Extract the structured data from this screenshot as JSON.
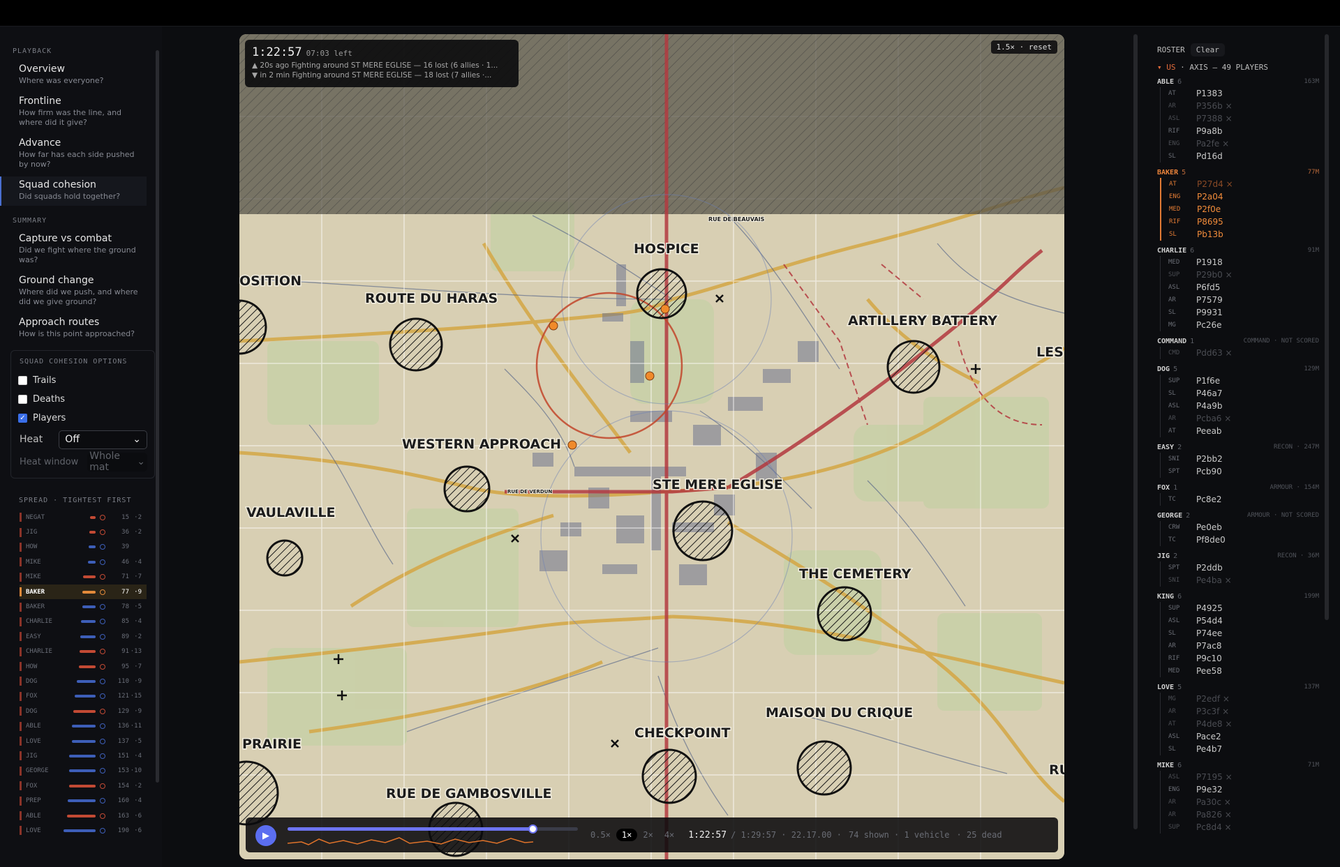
{
  "left": {
    "playback_header": "PLAYBACK",
    "playback": [
      {
        "t": "Overview",
        "d": "Where was everyone?"
      },
      {
        "t": "Frontline",
        "d": "How firm was the line, and where did it give?"
      },
      {
        "t": "Advance",
        "d": "How far has each side pushed by now?"
      },
      {
        "t": "Squad cohesion",
        "d": "Did squads hold together?"
      }
    ],
    "summary_header": "SUMMARY",
    "summary": [
      {
        "t": "Capture vs combat",
        "d": "Did we fight where the ground was?"
      },
      {
        "t": "Ground change",
        "d": "Where did we push, and where did we give ground?"
      },
      {
        "t": "Approach routes",
        "d": "How is this point approached?"
      }
    ],
    "options_header": "SQUAD COHESION OPTIONS",
    "options": {
      "trails": "Trails",
      "deaths": "Deaths",
      "players": "Players",
      "heat_label": "Heat",
      "heat_value": "Off",
      "heatwin_label": "Heat window",
      "heatwin_value": "Whole mat"
    },
    "spread_header": "SPREAD · TIGHTEST FIRST",
    "spread": [
      {
        "n": "NEGAT",
        "v": "15",
        "d": "2",
        "c": "#c24a34"
      },
      {
        "n": "JIG",
        "v": "36",
        "d": "2",
        "c": "#c24a34"
      },
      {
        "n": "HOW",
        "v": "39",
        "d": "",
        "c": "#3d5eb8"
      },
      {
        "n": "MIKE",
        "v": "46",
        "d": "4",
        "c": "#3d5eb8"
      },
      {
        "n": "MIKE",
        "v": "71",
        "d": "7",
        "c": "#c24a34"
      },
      {
        "n": "BAKER",
        "v": "77",
        "d": "9",
        "c": "#e38a3a"
      },
      {
        "n": "BAKER",
        "v": "78",
        "d": "5",
        "c": "#3d5eb8"
      },
      {
        "n": "CHARLIE",
        "v": "85",
        "d": "4",
        "c": "#3d5eb8"
      },
      {
        "n": "EASY",
        "v": "89",
        "d": "2",
        "c": "#3d5eb8"
      },
      {
        "n": "CHARLIE",
        "v": "91",
        "d": "13",
        "c": "#c24a34"
      },
      {
        "n": "HOW",
        "v": "95",
        "d": "7",
        "c": "#c24a34"
      },
      {
        "n": "DOG",
        "v": "110",
        "d": "9",
        "c": "#3d5eb8"
      },
      {
        "n": "FOX",
        "v": "121",
        "d": "15",
        "c": "#3d5eb8"
      },
      {
        "n": "DOG",
        "v": "129",
        "d": "9",
        "c": "#c24a34"
      },
      {
        "n": "ABLE",
        "v": "136",
        "d": "11",
        "c": "#3d5eb8"
      },
      {
        "n": "LOVE",
        "v": "137",
        "d": "5",
        "c": "#3d5eb8"
      },
      {
        "n": "JIG",
        "v": "151",
        "d": "4",
        "c": "#3d5eb8"
      },
      {
        "n": "GEORGE",
        "v": "153",
        "d": "10",
        "c": "#3d5eb8"
      },
      {
        "n": "FOX",
        "v": "154",
        "d": "2",
        "c": "#c24a34"
      },
      {
        "n": "PREP",
        "v": "160",
        "d": "4",
        "c": "#3d5eb8"
      },
      {
        "n": "ABLE",
        "v": "163",
        "d": "6",
        "c": "#c24a34"
      },
      {
        "n": "LOVE",
        "v": "190",
        "d": "6",
        "c": "#3d5eb8"
      }
    ]
  },
  "map": {
    "time": "1:22:57",
    "left": "07:03 left",
    "event1": "▲ 20s ago  Fighting around ST MERE EGLISE — 16 lost (6 allies · 1...",
    "event2": "▼ in 2 min  Fighting around ST MERE EGLISE — 18 lost (7 allies ·...",
    "zoom": "1.5× · reset",
    "labels": [
      "HOSPICE",
      "ROUTE DU HARAS",
      "ARTILLERY BATTERY",
      "WESTERN APPROACH",
      "STE MERE EGLISE",
      "VAULAVILLE",
      "THE CEMETERY",
      "MAISON DU CRIQUE",
      "CHECKPOINT",
      "PRAIRIE",
      "RUE DE GAMBOSVILLE",
      "OSITION",
      "LES",
      "RU",
      "RUE DE BEAUVAIS",
      "RUE DE VERDUN"
    ],
    "controls": {
      "s05": "0.5×",
      "s1": "1×",
      "s2": "2×",
      "s4": "4×",
      "cur": "1:22:57",
      "total": "/ 1:29:57 · 22.17.00 ·",
      "shown": "74 shown · 1 vehicle",
      "dead": "· 25 dead"
    }
  },
  "roster": {
    "title": "ROSTER",
    "clear": "Clear",
    "team_us": "▾ US",
    "team_rest": "· AXIS — 49 PLAYERS",
    "squads": [
      {
        "name": "ABLE",
        "count": "6",
        "meta": "163M",
        "orange": false,
        "players": [
          [
            "AT",
            "P1383",
            false
          ],
          [
            "AR",
            "P356b ×",
            true
          ],
          [
            "ASL",
            "P7388 ×",
            true
          ],
          [
            "RIF",
            "P9a8b",
            false
          ],
          [
            "ENG",
            "Pa2fe ×",
            true
          ],
          [
            "SL",
            "Pd16d",
            false
          ]
        ]
      },
      {
        "name": "BAKER",
        "count": "5",
        "meta": "77M",
        "orange": true,
        "players": [
          [
            "AT",
            "P27d4 ×",
            true
          ],
          [
            "ENG",
            "P2a04",
            false
          ],
          [
            "MED",
            "P2f0e",
            false
          ],
          [
            "RIF",
            "P8695",
            false
          ],
          [
            "SL",
            "Pb13b",
            false
          ]
        ]
      },
      {
        "name": "CHARLIE",
        "count": "6",
        "meta": "91M",
        "orange": false,
        "players": [
          [
            "MED",
            "P1918",
            false
          ],
          [
            "SUP",
            "P29b0 ×",
            true
          ],
          [
            "ASL",
            "P6fd5",
            false
          ],
          [
            "AR",
            "P7579",
            false
          ],
          [
            "SL",
            "P9931",
            false
          ],
          [
            "MG",
            "Pc26e",
            false
          ]
        ]
      },
      {
        "name": "COMMAND",
        "count": "1",
        "meta": "COMMAND · NOT SCORED",
        "orange": false,
        "players": [
          [
            "CMD",
            "Pdd63 ×",
            true
          ]
        ]
      },
      {
        "name": "DOG",
        "count": "5",
        "meta": "129M",
        "orange": false,
        "players": [
          [
            "SUP",
            "P1f6e",
            false
          ],
          [
            "SL",
            "P46a7",
            false
          ],
          [
            "ASL",
            "P4a9b",
            false
          ],
          [
            "AR",
            "Pcba6 ×",
            true
          ],
          [
            "AT",
            "Peeab",
            false
          ]
        ]
      },
      {
        "name": "EASY",
        "count": "2",
        "meta": "RECON · 247M",
        "orange": false,
        "players": [
          [
            "SNI",
            "P2bb2",
            false
          ],
          [
            "SPT",
            "Pcb90",
            false
          ]
        ]
      },
      {
        "name": "FOX",
        "count": "1",
        "meta": "ARMOUR · 154M",
        "orange": false,
        "players": [
          [
            "TC",
            "Pc8e2",
            false
          ]
        ]
      },
      {
        "name": "GEORGE",
        "count": "2",
        "meta": "ARMOUR · NOT SCORED",
        "orange": false,
        "players": [
          [
            "CRW",
            "Pe0eb",
            false
          ],
          [
            "TC",
            "Pf8de0",
            false
          ]
        ]
      },
      {
        "name": "JIG",
        "count": "2",
        "meta": "RECON · 36M",
        "orange": false,
        "players": [
          [
            "SPT",
            "P2ddb",
            false
          ],
          [
            "SNI",
            "Pe4ba ×",
            true
          ]
        ]
      },
      {
        "name": "KING",
        "count": "6",
        "meta": "199M",
        "orange": false,
        "players": [
          [
            "SUP",
            "P4925",
            false
          ],
          [
            "ASL",
            "P54d4",
            false
          ],
          [
            "SL",
            "P74ee",
            false
          ],
          [
            "AR",
            "P7ac8",
            false
          ],
          [
            "RIF",
            "P9c10",
            false
          ],
          [
            "MED",
            "Pee58",
            false
          ]
        ]
      },
      {
        "name": "LOVE",
        "count": "5",
        "meta": "137M",
        "orange": false,
        "players": [
          [
            "MG",
            "P2edf ×",
            true
          ],
          [
            "AR",
            "P3c3f ×",
            true
          ],
          [
            "AT",
            "P4de8 ×",
            true
          ],
          [
            "ASL",
            "Pace2",
            false
          ],
          [
            "SL",
            "Pe4b7",
            false
          ]
        ]
      },
      {
        "name": "MIKE",
        "count": "6",
        "meta": "71M",
        "orange": false,
        "players": [
          [
            "ASL",
            "P7195 ×",
            true
          ],
          [
            "ENG",
            "P9e32",
            false
          ],
          [
            "AR",
            "Pa30c ×",
            true
          ],
          [
            "AR",
            "Pa826 ×",
            true
          ],
          [
            "SUP",
            "Pc8d4 ×",
            true
          ]
        ]
      }
    ]
  }
}
